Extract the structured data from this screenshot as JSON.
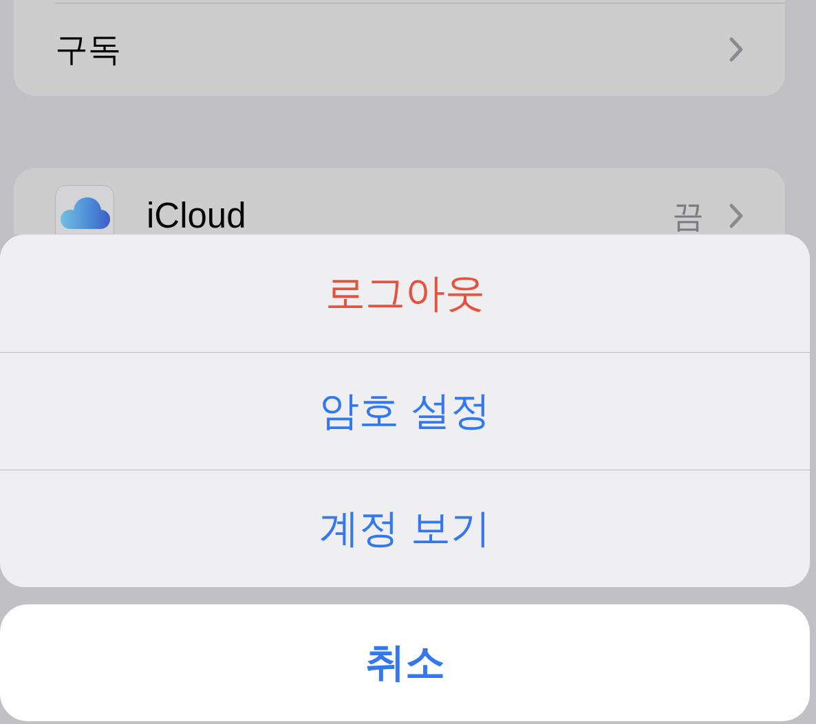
{
  "groups": [
    {
      "rows": [
        {
          "kind": "plain",
          "label": "구독"
        }
      ]
    },
    {
      "rows": [
        {
          "kind": "app",
          "label": "iCloud",
          "value": "끔"
        }
      ]
    }
  ],
  "action_sheet": {
    "actions": [
      {
        "kind": "destructive",
        "label": "로그아웃"
      },
      {
        "kind": "default",
        "label": "암호 설정"
      },
      {
        "kind": "default",
        "label": "계정 보기"
      }
    ],
    "cancel": {
      "label": "취소"
    }
  }
}
